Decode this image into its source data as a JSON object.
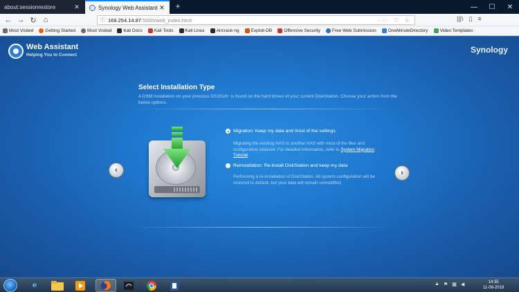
{
  "browser": {
    "tabs": [
      {
        "title": "about:sessionrestore",
        "active": false
      },
      {
        "title": "Synology Web Assistant",
        "active": true
      }
    ],
    "new_tab_icon": "plus-icon",
    "url": {
      "host": "169.254.14.87",
      "path": ":5000/web_index.html"
    },
    "bookmarks": [
      {
        "label": "Most Visited",
        "color": "#6c6c6c"
      },
      {
        "label": "Getting Started",
        "color": "#e66000"
      },
      {
        "label": "Most Visited",
        "color": "#6c6c6c"
      },
      {
        "label": "Kali Docs",
        "color": "#2a2a2a"
      },
      {
        "label": "Kali Tools",
        "color": "#c0392b"
      },
      {
        "label": "Kali Linux",
        "color": "#2a2a2a"
      },
      {
        "label": "Aircrack-ng",
        "color": "#2a2a2a"
      },
      {
        "label": "Exploit-DB",
        "color": "#d35400"
      },
      {
        "label": "Offensive Security",
        "color": "#c0392b"
      },
      {
        "label": "Free Web Submission",
        "color": "#2f6fb7"
      },
      {
        "label": "OneMinuteDirectory",
        "color": "#3a7bd5"
      },
      {
        "label": "Video Templates",
        "color": "#4a9d5b"
      }
    ]
  },
  "app": {
    "title": "Web Assistant",
    "subtitle": "Helping You to Connect",
    "brand": "Synology"
  },
  "install": {
    "heading": "Select Installation Type",
    "description": "A DSM installation on your previous DS1618+ is found on the hard drives of your current DiskStation. Choose your action from the below options.",
    "options": [
      {
        "label": "Migration: Keep my data and most of the settings",
        "selected": true,
        "desc_before": "Migrating the existing NAS to another NAS with most of the files and configuration retained. For detailed information, refer to ",
        "link": "System Migration Tutorial",
        "desc_after": "."
      },
      {
        "label": "Reinstallation: Re-install DiskStation and keep my data",
        "selected": false,
        "desc": "Performing a re-installation of DiskStation. All system configuration will be restored to default, but your data will remain unmodified."
      }
    ],
    "accent_color": "#2bb53c"
  },
  "taskbar": {
    "clock_time": "14:35",
    "clock_date": "11-06-2019"
  }
}
